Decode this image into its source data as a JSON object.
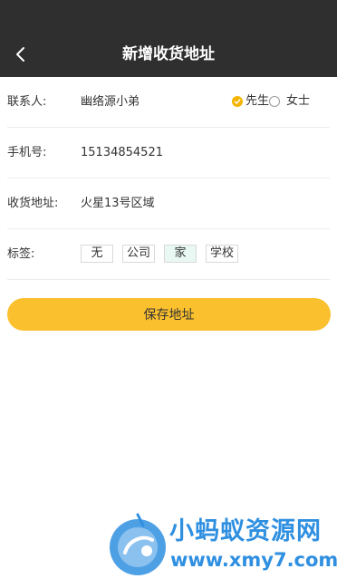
{
  "header": {
    "title": "新增收货地址",
    "back_icon": "chevron-left-icon"
  },
  "form": {
    "contact": {
      "label": "联系人:",
      "value": "幽络源小弟"
    },
    "gender": {
      "options": [
        {
          "label": "先生",
          "checked": true
        },
        {
          "label": "女士",
          "checked": false
        }
      ]
    },
    "phone": {
      "label": "手机号:",
      "value": "15134854521"
    },
    "address": {
      "label": "收货地址:",
      "value": "火星13号区域"
    },
    "tags": {
      "label": "标签:",
      "items": [
        "无",
        "公司",
        "家",
        "学校"
      ],
      "selected": "家"
    }
  },
  "save_button": {
    "label": "保存地址"
  },
  "watermark": {
    "text_cn": "小蚂蚁资源网",
    "url": "www.xmy7.com"
  },
  "colors": {
    "header_bg": "#2f2f2f",
    "accent": "#fbc02d",
    "watermark": "#2f8fe0"
  }
}
